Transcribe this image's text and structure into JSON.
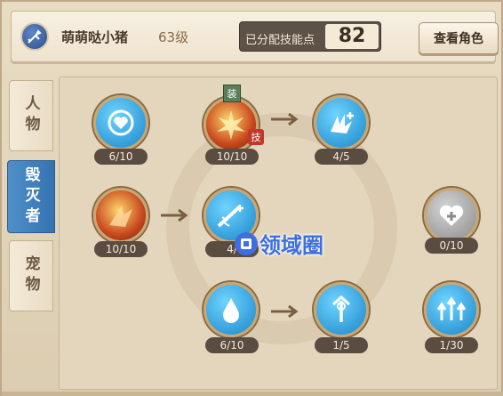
{
  "header": {
    "player_name": "萌萌哒小猪",
    "player_level": "63级",
    "points_label": "已分配技能点",
    "points_value": "82",
    "view_role_label": "查看角色"
  },
  "tabs": [
    {
      "label": "人物",
      "active": false
    },
    {
      "label": "毁灭者",
      "active": true
    },
    {
      "label": "宠物",
      "active": false
    }
  ],
  "skills": [
    {
      "icon": "heart-icon",
      "level": "6/10"
    },
    {
      "icon": "fire-burst-icon",
      "level": "10/10",
      "equip_tag": "装",
      "skill_tag": "技"
    },
    {
      "icon": "shatter-plus-icon",
      "level": "4/5"
    },
    {
      "icon": "fire-slash-icon",
      "level": "10/10"
    },
    {
      "icon": "sword-up-icon",
      "level": "4/"
    },
    {
      "icon": "heal-plus-icon",
      "level": "0/10"
    },
    {
      "icon": "water-drop-icon",
      "level": "6/10"
    },
    {
      "icon": "trident-icon",
      "level": "1/5"
    },
    {
      "icon": "triple-arrow-up-icon",
      "level": "1/30"
    }
  ],
  "watermark": {
    "text": "领域圈"
  },
  "colors": {
    "active_tab": "#3f82c0",
    "points_bg": "#5d5148",
    "level_bg": "#5a4c40"
  }
}
